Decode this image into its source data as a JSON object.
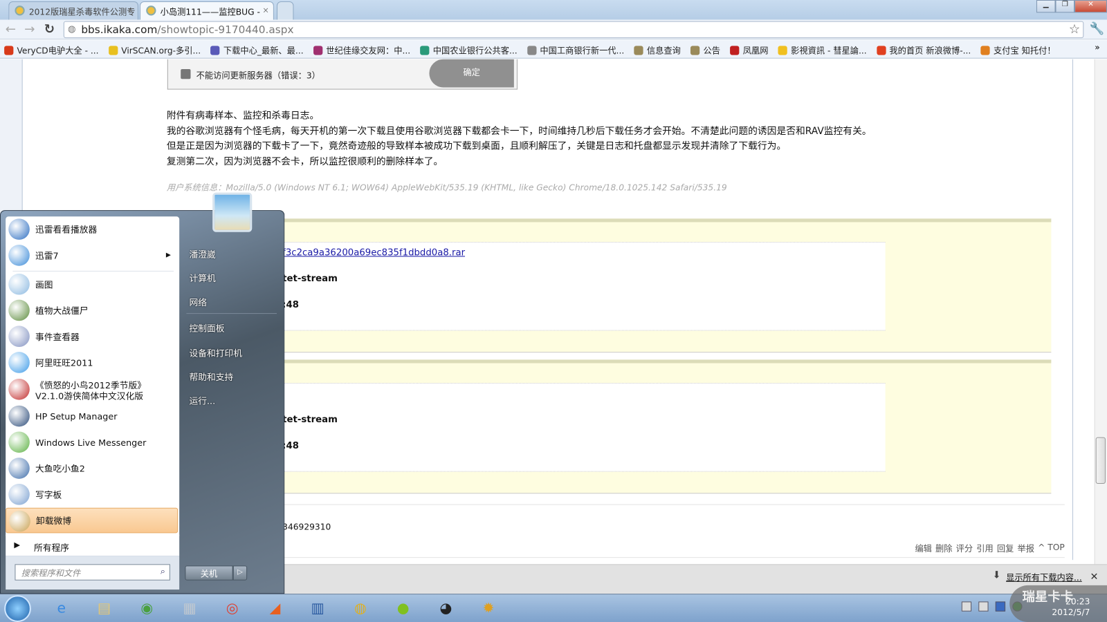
{
  "browser": {
    "tabs": [
      {
        "title": "2012版瑞星杀毒软件公测专",
        "close": "×"
      },
      {
        "title": "小岛测111——监控BUG -",
        "close": "×"
      }
    ],
    "url_host": "bbs.ikaka.com",
    "url_path": "/showtopic-9170440.aspx",
    "bookmarks": [
      {
        "label": "VeryCD电驴大全 - ...",
        "color": "#d83a1a"
      },
      {
        "label": "VirSCAN.org-多引...",
        "color": "#e8c020"
      },
      {
        "label": "下载中心_最新、最...",
        "color": "#5a5ab8"
      },
      {
        "label": "世纪佳缘交友网：中...",
        "color": "#a03070"
      },
      {
        "label": "中国农业银行公共客...",
        "color": "#2a9a7a"
      },
      {
        "label": "中国工商银行新一代...",
        "color": "#888888"
      },
      {
        "label": "信息查询",
        "color": "#9a8a5a"
      },
      {
        "label": "公告",
        "color": "#9a8a5a"
      },
      {
        "label": "凤凰网",
        "color": "#c02020"
      },
      {
        "label": "影視資訊 - 彗星論...",
        "color": "#f0c020"
      },
      {
        "label": "我的首页 新浪微博-...",
        "color": "#e04020"
      },
      {
        "label": "支付宝 知托付！",
        "color": "#e08020"
      }
    ]
  },
  "page": {
    "error_text": "不能访问更新服务器（错误：3）",
    "ok_button": "确定",
    "paragraphs": [
      "附件有病毒样本、监控和杀毒日志。",
      "我的谷歌浏览器有个怪毛病，每天开机的第一次下载且使用谷歌浏览器下载都会卡一下，时间维持几秒后下载任务才会开始。不清楚此问题的诱因是否和RAV监控有关。",
      "但是正是因为浏览器的下载卡了一下，竟然奇迹般的导致样本被成功下载到桌面，且顺利解压了，关键是日志和托盘都显示发现并清除了下载行为。",
      "复测第二次，因为浏览器不会卡，所以监控很顺利的删除样本了。"
    ],
    "user_agent": "用户系统信息：Mozilla/5.0 (Windows NT 6.1; WOW64) AppleWebKit/535.19 (KHTML, like Gecko) Chrome/18.0.1025.142 Safari/535.19",
    "attachments": [
      {
        "link": "f3c2ca9a36200a69ec835f1dbdd0a8.rar",
        "type": "tet-stream",
        "time": ":48"
      },
      {
        "type": "tet-stream",
        "time": ":48"
      }
    ],
    "signature": "346929310",
    "actions": [
      "编辑",
      "删除",
      "评分",
      "引用",
      "回复",
      "举报",
      "^ TOP"
    ]
  },
  "download_shelf": {
    "show_all": "显示所有下载内容...",
    "close": "✕"
  },
  "start_menu": {
    "programs": [
      {
        "label": "迅雷看看播放器",
        "color": "#2a6cc0"
      },
      {
        "label": "迅雷7",
        "color": "#3a8ad8",
        "submenu": "▶"
      },
      {
        "label": "画图",
        "color": "#8ab8e0"
      },
      {
        "label": "植物大战僵尸",
        "color": "#5a8a3a"
      },
      {
        "label": "事件查看器",
        "color": "#8090c0"
      },
      {
        "label": "阿里旺旺2011",
        "color": "#3a9ae8"
      },
      {
        "label": "《愤怒的小鸟2012季节版》\nV2.1.0游侠简体中文汉化版",
        "line1": "《愤怒的小鸟2012季节版》",
        "line2": "V2.1.0游侠简体中文汉化版",
        "color": "#c02828"
      },
      {
        "label": "HP Setup Manager",
        "color": "#2a4a78"
      },
      {
        "label": "Windows Live Messenger",
        "color": "#5ab040"
      },
      {
        "label": "大鱼吃小鱼2",
        "color": "#3a6aa8"
      },
      {
        "label": "写字板",
        "color": "#7aa0d0"
      },
      {
        "label": "卸载微博",
        "color": "#c8a050"
      }
    ],
    "all_programs": "所有程序",
    "search_placeholder": "搜索程序和文件",
    "right_items": [
      "潘澄崴",
      "计算机",
      "网络",
      "控制面板",
      "设备和打印机",
      "帮助和支持",
      "运行..."
    ],
    "shutdown": "关机"
  },
  "taskbar": {
    "clock_time": "20:23",
    "clock_date": "2012/5/7",
    "watermark": "瑞星卡卡",
    "apps": [
      {
        "name": "internet-explorer",
        "glyph": "e",
        "color": "#3a8ae0"
      },
      {
        "name": "file-explorer",
        "glyph": "▤",
        "color": "#e8c870"
      },
      {
        "name": "network-app",
        "glyph": "◉",
        "color": "#4aa040"
      },
      {
        "name": "calculator",
        "glyph": "▦",
        "color": "#c0c8d0"
      },
      {
        "name": "chrome",
        "glyph": "◎",
        "color": "#e04030"
      },
      {
        "name": "app-orange",
        "glyph": "◢",
        "color": "#e86020"
      },
      {
        "name": "firewall",
        "glyph": "▥",
        "color": "#2a5aa0"
      },
      {
        "name": "rising-antivirus",
        "glyph": "◍",
        "color": "#e0b020"
      },
      {
        "name": "app-green",
        "glyph": "●",
        "color": "#80c020"
      },
      {
        "name": "qq",
        "glyph": "◕",
        "color": "#222222"
      },
      {
        "name": "lion-app",
        "glyph": "✹",
        "color": "#e0a020"
      }
    ]
  }
}
